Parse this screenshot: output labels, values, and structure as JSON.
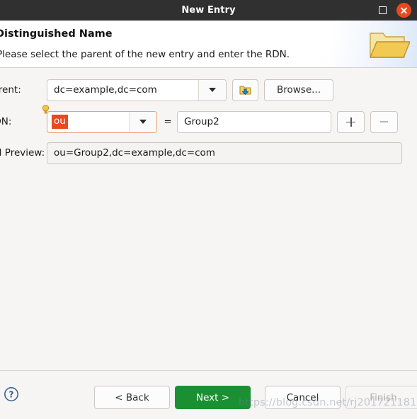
{
  "window": {
    "title": "New Entry",
    "maximize_label": "Maximize",
    "close_label": "Close"
  },
  "header": {
    "title": "Distinguished Name",
    "subtitle": "Please select the parent of the new entry and enter the RDN.",
    "icon": "open-folder-icon"
  },
  "form": {
    "parent": {
      "label": "Parent:",
      "value": "dc=example,dc=com",
      "dropdown_icon": "chevron-down-icon",
      "history_icon": "folder-up-arrow-icon",
      "browse_label": "Browse..."
    },
    "rdn": {
      "label": "RDN:",
      "attribute_value": "ou",
      "attribute_selected": true,
      "hint_icon": "lightbulb-icon",
      "dropdown_icon": "chevron-down-icon",
      "equals": "=",
      "value": "Group2",
      "add_label": "+",
      "remove_label": "−"
    },
    "preview": {
      "label": "DN Preview:",
      "value": "ou=Group2,dc=example,dc=com"
    }
  },
  "footer": {
    "help_icon": "help-circle-icon",
    "back_label": "< Back",
    "next_label": "Next >",
    "cancel_label": "Cancel",
    "finish_label": "Finish",
    "finish_disabled": true
  },
  "watermark": {
    "text": "https://blog.csdn.net/rj2017211811"
  },
  "colors": {
    "titlebar_bg": "#303030",
    "close_button": "#e8491d",
    "primary_button": "#1a9033",
    "selection": "#e8491d",
    "body_bg": "#f6f5f4",
    "error_border": "#e8a07a"
  }
}
